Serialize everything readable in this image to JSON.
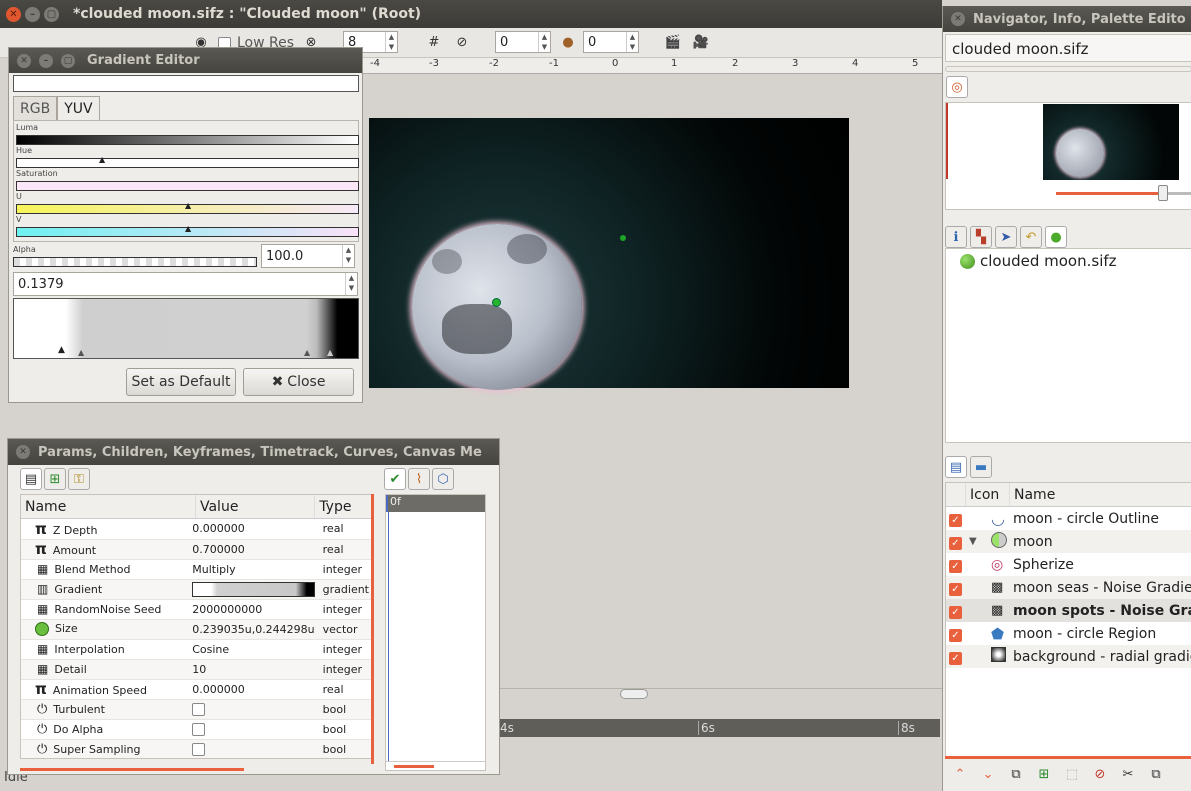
{
  "main_window": {
    "title": "*clouded moon.sifz : \"Clouded moon\" (Root)",
    "toolbar": {
      "low_res_label": "Low Res",
      "zoom_value": "8",
      "field1_value": "0",
      "field2_value": "0"
    },
    "ruler_ticks": [
      "-4",
      "-3",
      "-2",
      "-1",
      "0",
      "1",
      "2",
      "3",
      "4",
      "5"
    ],
    "timebar_ticks": [
      "4s",
      "6s",
      "8s"
    ],
    "status": "Idle"
  },
  "gradient_editor": {
    "title": "Gradient Editor",
    "tabs": [
      "RGB",
      "YUV"
    ],
    "active_tab": "YUV",
    "labels": {
      "luma": "Luma",
      "hue": "Hue",
      "saturation": "Saturation",
      "u": "U",
      "v": "V",
      "alpha": "Alpha"
    },
    "alpha_value": "100.0",
    "position_value": "0.1379",
    "buttons": {
      "default": "Set as Default",
      "close": "Close"
    }
  },
  "params_panel": {
    "title": "Params, Children, Keyframes, Timetrack, Curves, Canvas Me",
    "columns": [
      "Name",
      "Value",
      "Type"
    ],
    "rows": [
      {
        "name": "Z Depth",
        "value": "0.000000",
        "type": "real",
        "icon": "pi-icon"
      },
      {
        "name": "Amount",
        "value": "0.700000",
        "type": "real",
        "icon": "pi-icon"
      },
      {
        "name": "Blend Method",
        "value": "Multiply",
        "type": "integer",
        "icon": "integer-icon"
      },
      {
        "name": "Gradient",
        "value": "",
        "type": "gradient",
        "icon": "gradient-icon"
      },
      {
        "name": "RandomNoise Seed",
        "value": "2000000000",
        "type": "integer",
        "icon": "integer-icon"
      },
      {
        "name": "Size",
        "value": "0.239035u,0.244298u",
        "type": "vector",
        "icon": "vector-icon"
      },
      {
        "name": "Interpolation",
        "value": "Cosine",
        "type": "integer",
        "icon": "integer-icon"
      },
      {
        "name": "Detail",
        "value": "10",
        "type": "integer",
        "icon": "integer-icon"
      },
      {
        "name": "Animation Speed",
        "value": "0.000000",
        "type": "real",
        "icon": "pi-icon"
      },
      {
        "name": "Turbulent",
        "value": "",
        "type": "bool",
        "icon": "power-icon"
      },
      {
        "name": "Do Alpha",
        "value": "",
        "type": "bool",
        "icon": "power-icon"
      },
      {
        "name": "Super Sampling",
        "value": "",
        "type": "bool",
        "icon": "power-icon"
      }
    ],
    "timetrack_label": "0f"
  },
  "navigator": {
    "title": "Navigator, Info, Palette Edito",
    "file_name": "clouded moon.sifz",
    "canvas_tree_item": "clouded moon.sifz"
  },
  "layers_panel": {
    "columns": [
      "Icon",
      "Name"
    ],
    "layers": [
      {
        "name": "moon - circle Outline",
        "icon": "outline-icon",
        "expander": ""
      },
      {
        "name": "moon",
        "icon": "group-icon",
        "expander": "▼"
      },
      {
        "name": "Spherize",
        "icon": "spherize-icon",
        "expander": ""
      },
      {
        "name": "moon seas - Noise Gradient",
        "icon": "noise-icon",
        "expander": ""
      },
      {
        "name": "moon spots - Noise Gradient",
        "icon": "noise-icon",
        "expander": ""
      },
      {
        "name": "moon - circle Region",
        "icon": "region-icon",
        "expander": ""
      },
      {
        "name": "background - radial gradient",
        "icon": "radial-icon",
        "expander": ""
      }
    ]
  }
}
